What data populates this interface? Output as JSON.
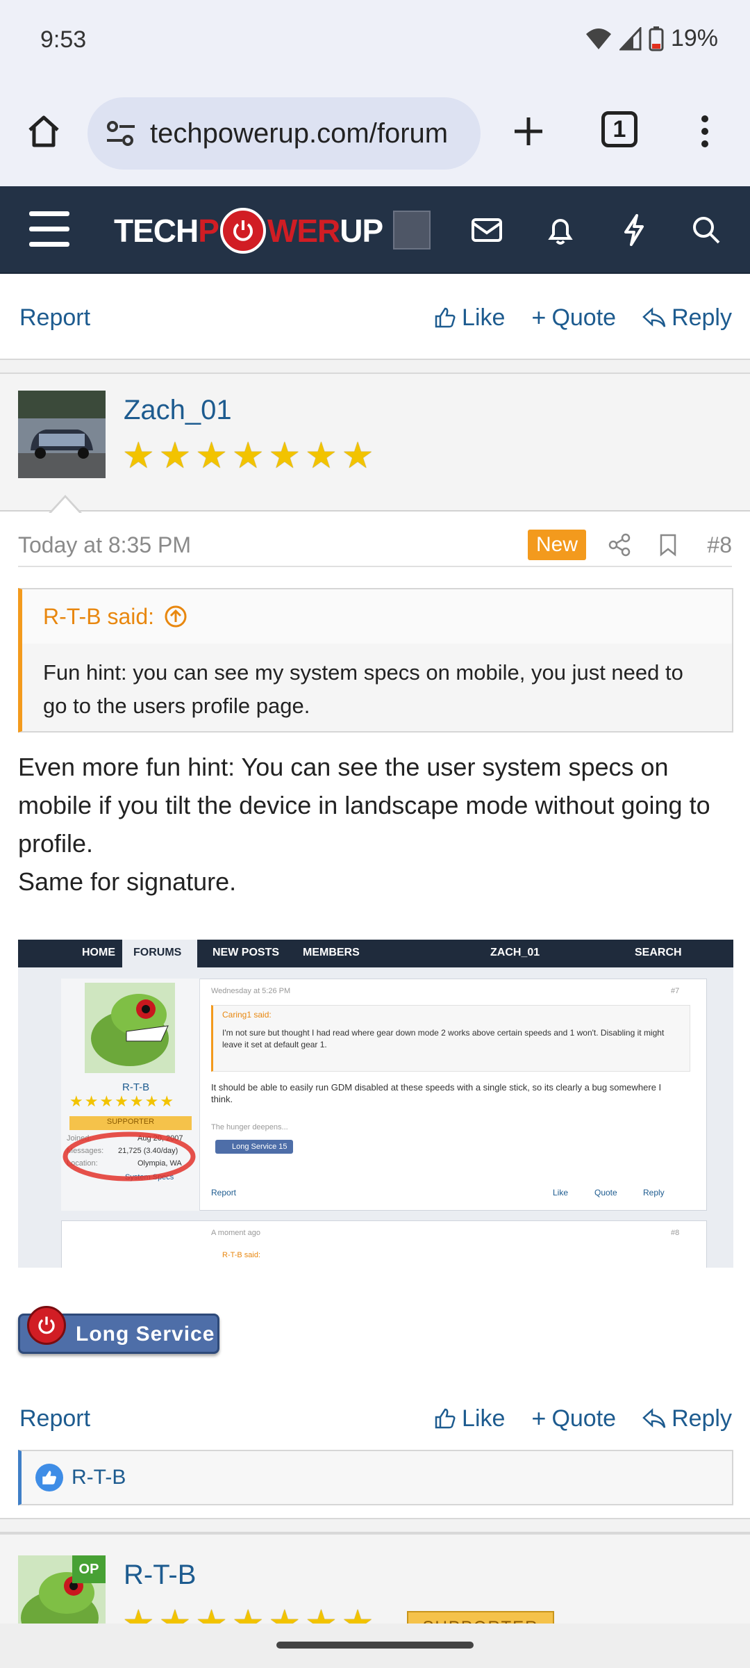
{
  "status": {
    "time": "9:53",
    "battery": "19%"
  },
  "browser": {
    "url": "techpowerup.com/forum",
    "tab_count": "1"
  },
  "site": {
    "logo_left": "TECH",
    "logo_mid": "WER",
    "logo_right": "UP"
  },
  "prev_actions": {
    "report": "Report",
    "like": "Like",
    "quote": "Quote",
    "reply": "Reply"
  },
  "post": {
    "username": "Zach_01",
    "stars": [
      "★",
      "★",
      "★",
      "★",
      "★",
      "★",
      "★"
    ],
    "date": "Today at 8:35 PM",
    "new_badge": "New",
    "post_number": "#8",
    "quote_author": "R-T-B said:",
    "quote_text": "Fun hint: you can see my system specs on mobile, you just need to go to the users profile page.",
    "body_lines": [
      "Even more fun hint: You can see the user system specs on mobile if you tilt the device in landscape mode without going to profile.",
      "Same for signature."
    ],
    "attachment": {
      "nav": [
        "HOME",
        "FORUMS",
        "NEW POSTS",
        "MEMBERS",
        "ZACH_01",
        "SEARCH"
      ],
      "user": "R-T-B",
      "supporter": "SUPPORTER",
      "joined_label": "Joined:",
      "joined": "Aug 20, 2007",
      "messages_label": "Messages:",
      "messages": "21,725 (3.40/day)",
      "location_label": "Location:",
      "location": "Olympia, WA",
      "specs": "System Specs",
      "date": "Wednesday at 5:26 PM",
      "num": "#7",
      "quote_author": "Caring1 said:",
      "quote_text": "I'm not sure but thought I had read where gear down mode 2 works above certain speeds and 1 won't. Disabling it might leave it set at default gear 1.",
      "body": "It should be able to easily run GDM disabled at these speeds with a single stick, so its clearly a bug somewhere I think.",
      "sig": "The hunger deepens...",
      "badge": "Long Service 15",
      "report": "Report",
      "like": "Like",
      "quote": "Quote",
      "reply": "Reply",
      "date2": "A moment ago",
      "num2": "#8",
      "quote2": "R-T-B said:"
    },
    "badge": "Long Service",
    "actions": {
      "report": "Report",
      "like": "Like",
      "quote": "Quote",
      "reply": "Reply"
    },
    "reaction_user": "R-T-B"
  },
  "next_post": {
    "username": "R-T-B",
    "op": "OP",
    "supporter": "SUPPORTER",
    "stars": [
      "★",
      "★",
      "★",
      "★",
      "★",
      "★",
      "★"
    ]
  },
  "colors": {
    "nav_bg": "#233246",
    "link": "#1d5b8f",
    "accent_orange": "#f39a1d",
    "brand_red": "#d11d24"
  }
}
